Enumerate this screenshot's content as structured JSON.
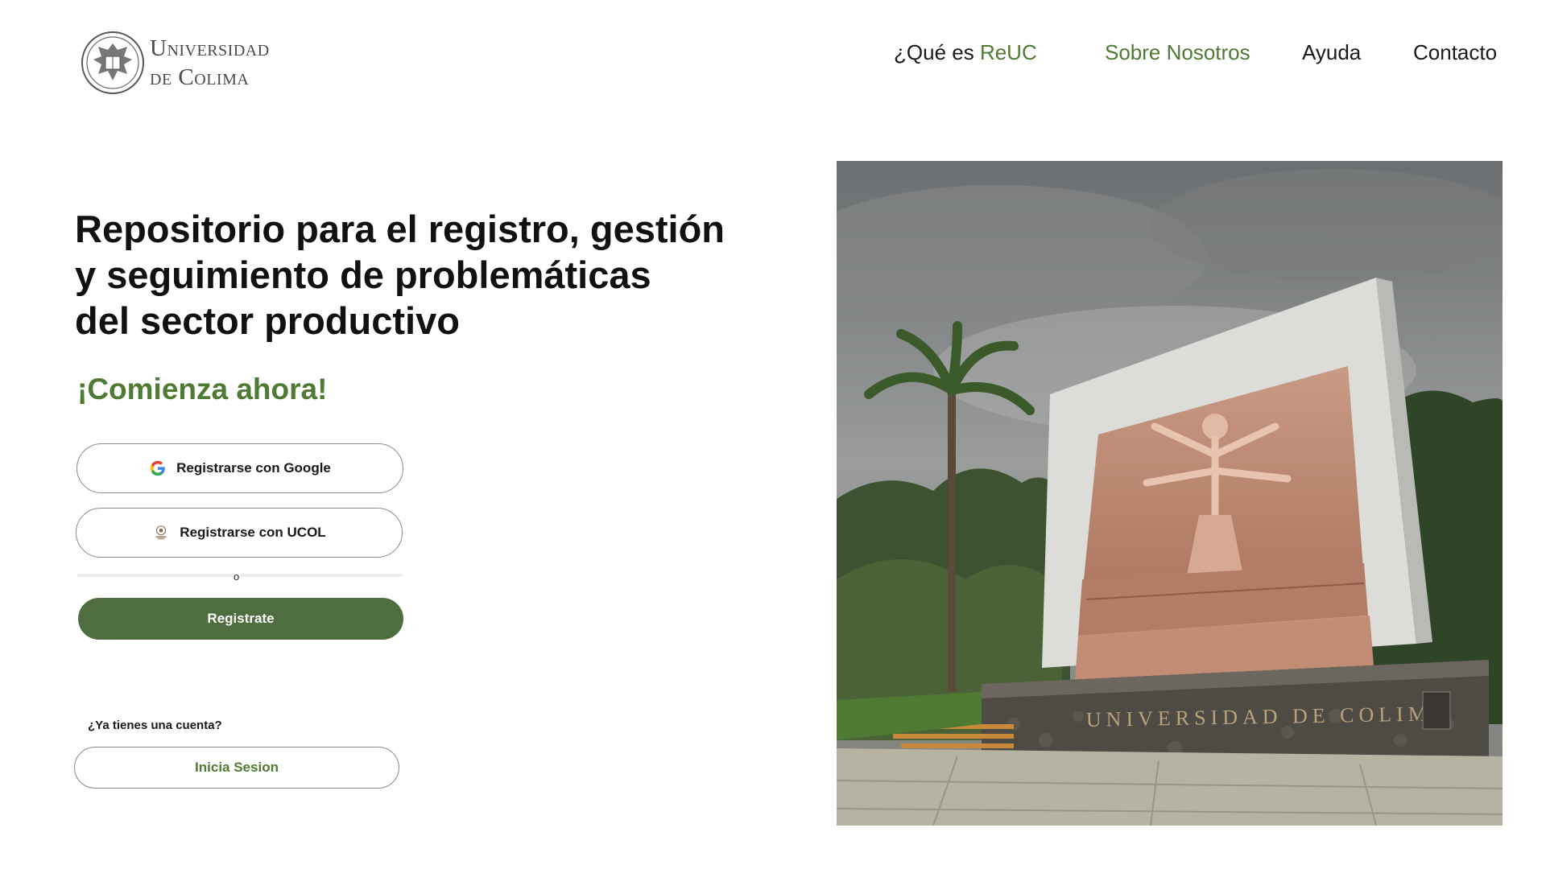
{
  "header": {
    "logo": {
      "line1": "Universidad",
      "line2": "de Colima",
      "seal_icon": "university-seal-icon"
    },
    "nav": {
      "que_es_prefix": "¿Qué es ",
      "que_es_brand": "ReUC",
      "sobre_nosotros": "Sobre Nosotros",
      "ayuda": "Ayuda",
      "contacto": "Contacto"
    }
  },
  "hero": {
    "headline": [
      "Repositorio para el registro, gestión",
      "y seguimiento de problemáticas",
      "del sector productivo"
    ],
    "subheadline": "¡Comienza ahora!",
    "google_button": {
      "label": "Registrarse con Google",
      "icon": "google-icon"
    },
    "ucol_button": {
      "label": "Registrarse con UCOL",
      "icon": "ucol-seal-icon"
    },
    "divider_label": "o",
    "register_button": "Registrate",
    "have_account": "¿Ya tienes una cuenta?",
    "login_button": "Inicia Sesion"
  },
  "image": {
    "inscription": "UNIVERSIDAD DE COLIMA"
  },
  "colors": {
    "accent_green": "#4f7a34",
    "button_green": "#4e6e3f",
    "text_dark": "#111111"
  }
}
